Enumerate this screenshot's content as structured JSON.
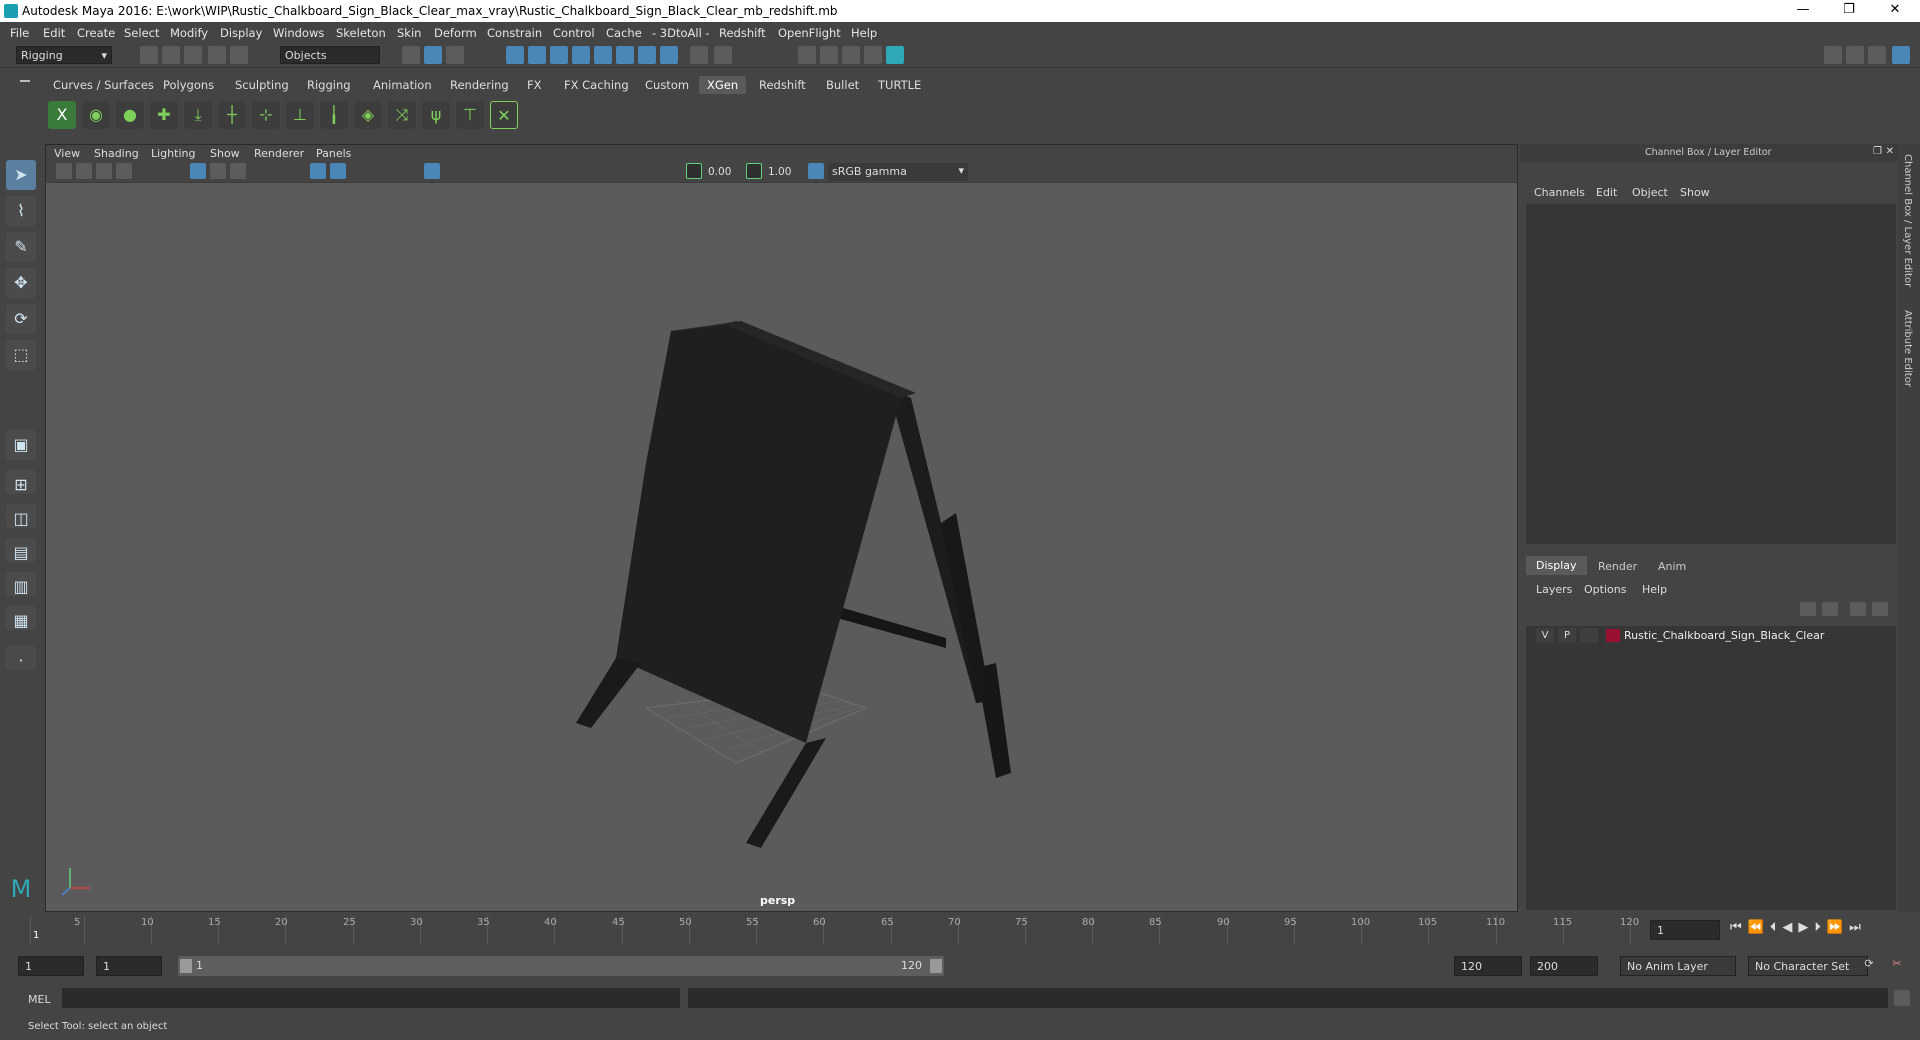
{
  "window": {
    "title": "Autodesk Maya 2016: E:\\work\\WIP\\Rustic_Chalkboard_Sign_Black_Clear_max_vray\\Rustic_Chalkboard_Sign_Black_Clear_mb_redshift.mb",
    "minimize": "—",
    "restore": "❐",
    "close": "✕"
  },
  "menubar": [
    "File",
    "Edit",
    "Create",
    "Select",
    "Modify",
    "Display",
    "Windows",
    "Skeleton",
    "Skin",
    "Deform",
    "Constrain",
    "Control",
    "Cache",
    "- 3DtoAll -",
    "Redshift",
    "OpenFlight",
    "Help"
  ],
  "statusline": {
    "mode": "Rigging",
    "selection_mode": "Objects"
  },
  "shelf_tabs": [
    "Curves / Surfaces",
    "Polygons",
    "Sculpting",
    "Rigging",
    "Animation",
    "Rendering",
    "FX",
    "FX Caching",
    "Custom",
    "XGen",
    "Redshift",
    "Bullet",
    "TURTLE"
  ],
  "shelf_active": "XGen",
  "viewport": {
    "menu": [
      "View",
      "Shading",
      "Lighting",
      "Show",
      "Renderer",
      "Panels"
    ],
    "exposure": "0.00",
    "gamma": "1.00",
    "colorspace": "sRGB gamma",
    "camera_label": "persp"
  },
  "channelbox": {
    "header": "Channel Box / Layer Editor",
    "menu": [
      "Channels",
      "Edit",
      "Object",
      "Show"
    ]
  },
  "layer_editor": {
    "tabs": [
      "Display",
      "Render",
      "Anim"
    ],
    "active_tab": "Display",
    "menu": [
      "Layers",
      "Options",
      "Help"
    ],
    "layers": [
      {
        "v": "V",
        "p": "P",
        "name": "Rustic_Chalkboard_Sign_Black_Clear",
        "color": "#9a1030"
      }
    ]
  },
  "side_tabs": [
    "Channel Box / Layer Editor",
    "Attribute Editor"
  ],
  "timeline": {
    "ticks": [
      "1",
      "5",
      "10",
      "15",
      "20",
      "25",
      "30",
      "35",
      "40",
      "45",
      "50",
      "55",
      "60",
      "65",
      "70",
      "75",
      "80",
      "85",
      "90",
      "95",
      "100",
      "105",
      "110",
      "115",
      "120"
    ],
    "current_frame": "1"
  },
  "range": {
    "start": "1",
    "playback_start": "1",
    "slider_start": "1",
    "slider_end": "120",
    "playback_end": "120",
    "end": "200",
    "anim_layer": "No Anim Layer",
    "character_set": "No Character Set"
  },
  "cmdline": {
    "label": "MEL"
  },
  "helpline": "Select Tool: select an object",
  "colors": {
    "accent": "#4a86b8",
    "bg": "#444444",
    "viewport": "#5b5b5b",
    "layer_color": "#9a1030"
  }
}
